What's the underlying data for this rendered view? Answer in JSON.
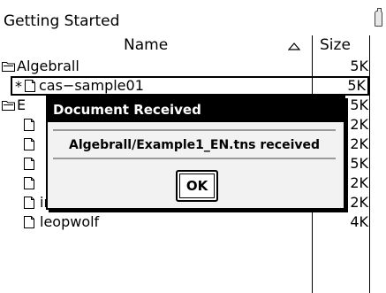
{
  "window": {
    "title": "Getting Started"
  },
  "columns": {
    "name": "Name",
    "size": "Size"
  },
  "rows": [
    {
      "mark": "",
      "icon": "folder-icon",
      "name": "Algebrall",
      "size": "5K"
    },
    {
      "mark": "*",
      "icon": "document-icon",
      "name": "cas−sample01",
      "size": "5K"
    },
    {
      "mark": "",
      "icon": "folder-icon",
      "name": "E",
      "size": "5K"
    },
    {
      "mark": "",
      "icon": "document-icon",
      "name": "",
      "size": "2K"
    },
    {
      "mark": "",
      "icon": "document-icon",
      "name": "",
      "size": "2K"
    },
    {
      "mark": "",
      "icon": "document-icon",
      "name": "",
      "size": "5K"
    },
    {
      "mark": "",
      "icon": "document-icon",
      "name": "",
      "size": "2K"
    },
    {
      "mark": "",
      "icon": "document-icon",
      "name": "inequalitiesretry",
      "size": "2K"
    },
    {
      "mark": "",
      "icon": "document-icon",
      "name": "leopwolf",
      "size": "4K"
    }
  ],
  "dialog": {
    "title": "Document Received",
    "message": "Algebrall/Example1_EN.tns received",
    "ok_label": "OK"
  }
}
